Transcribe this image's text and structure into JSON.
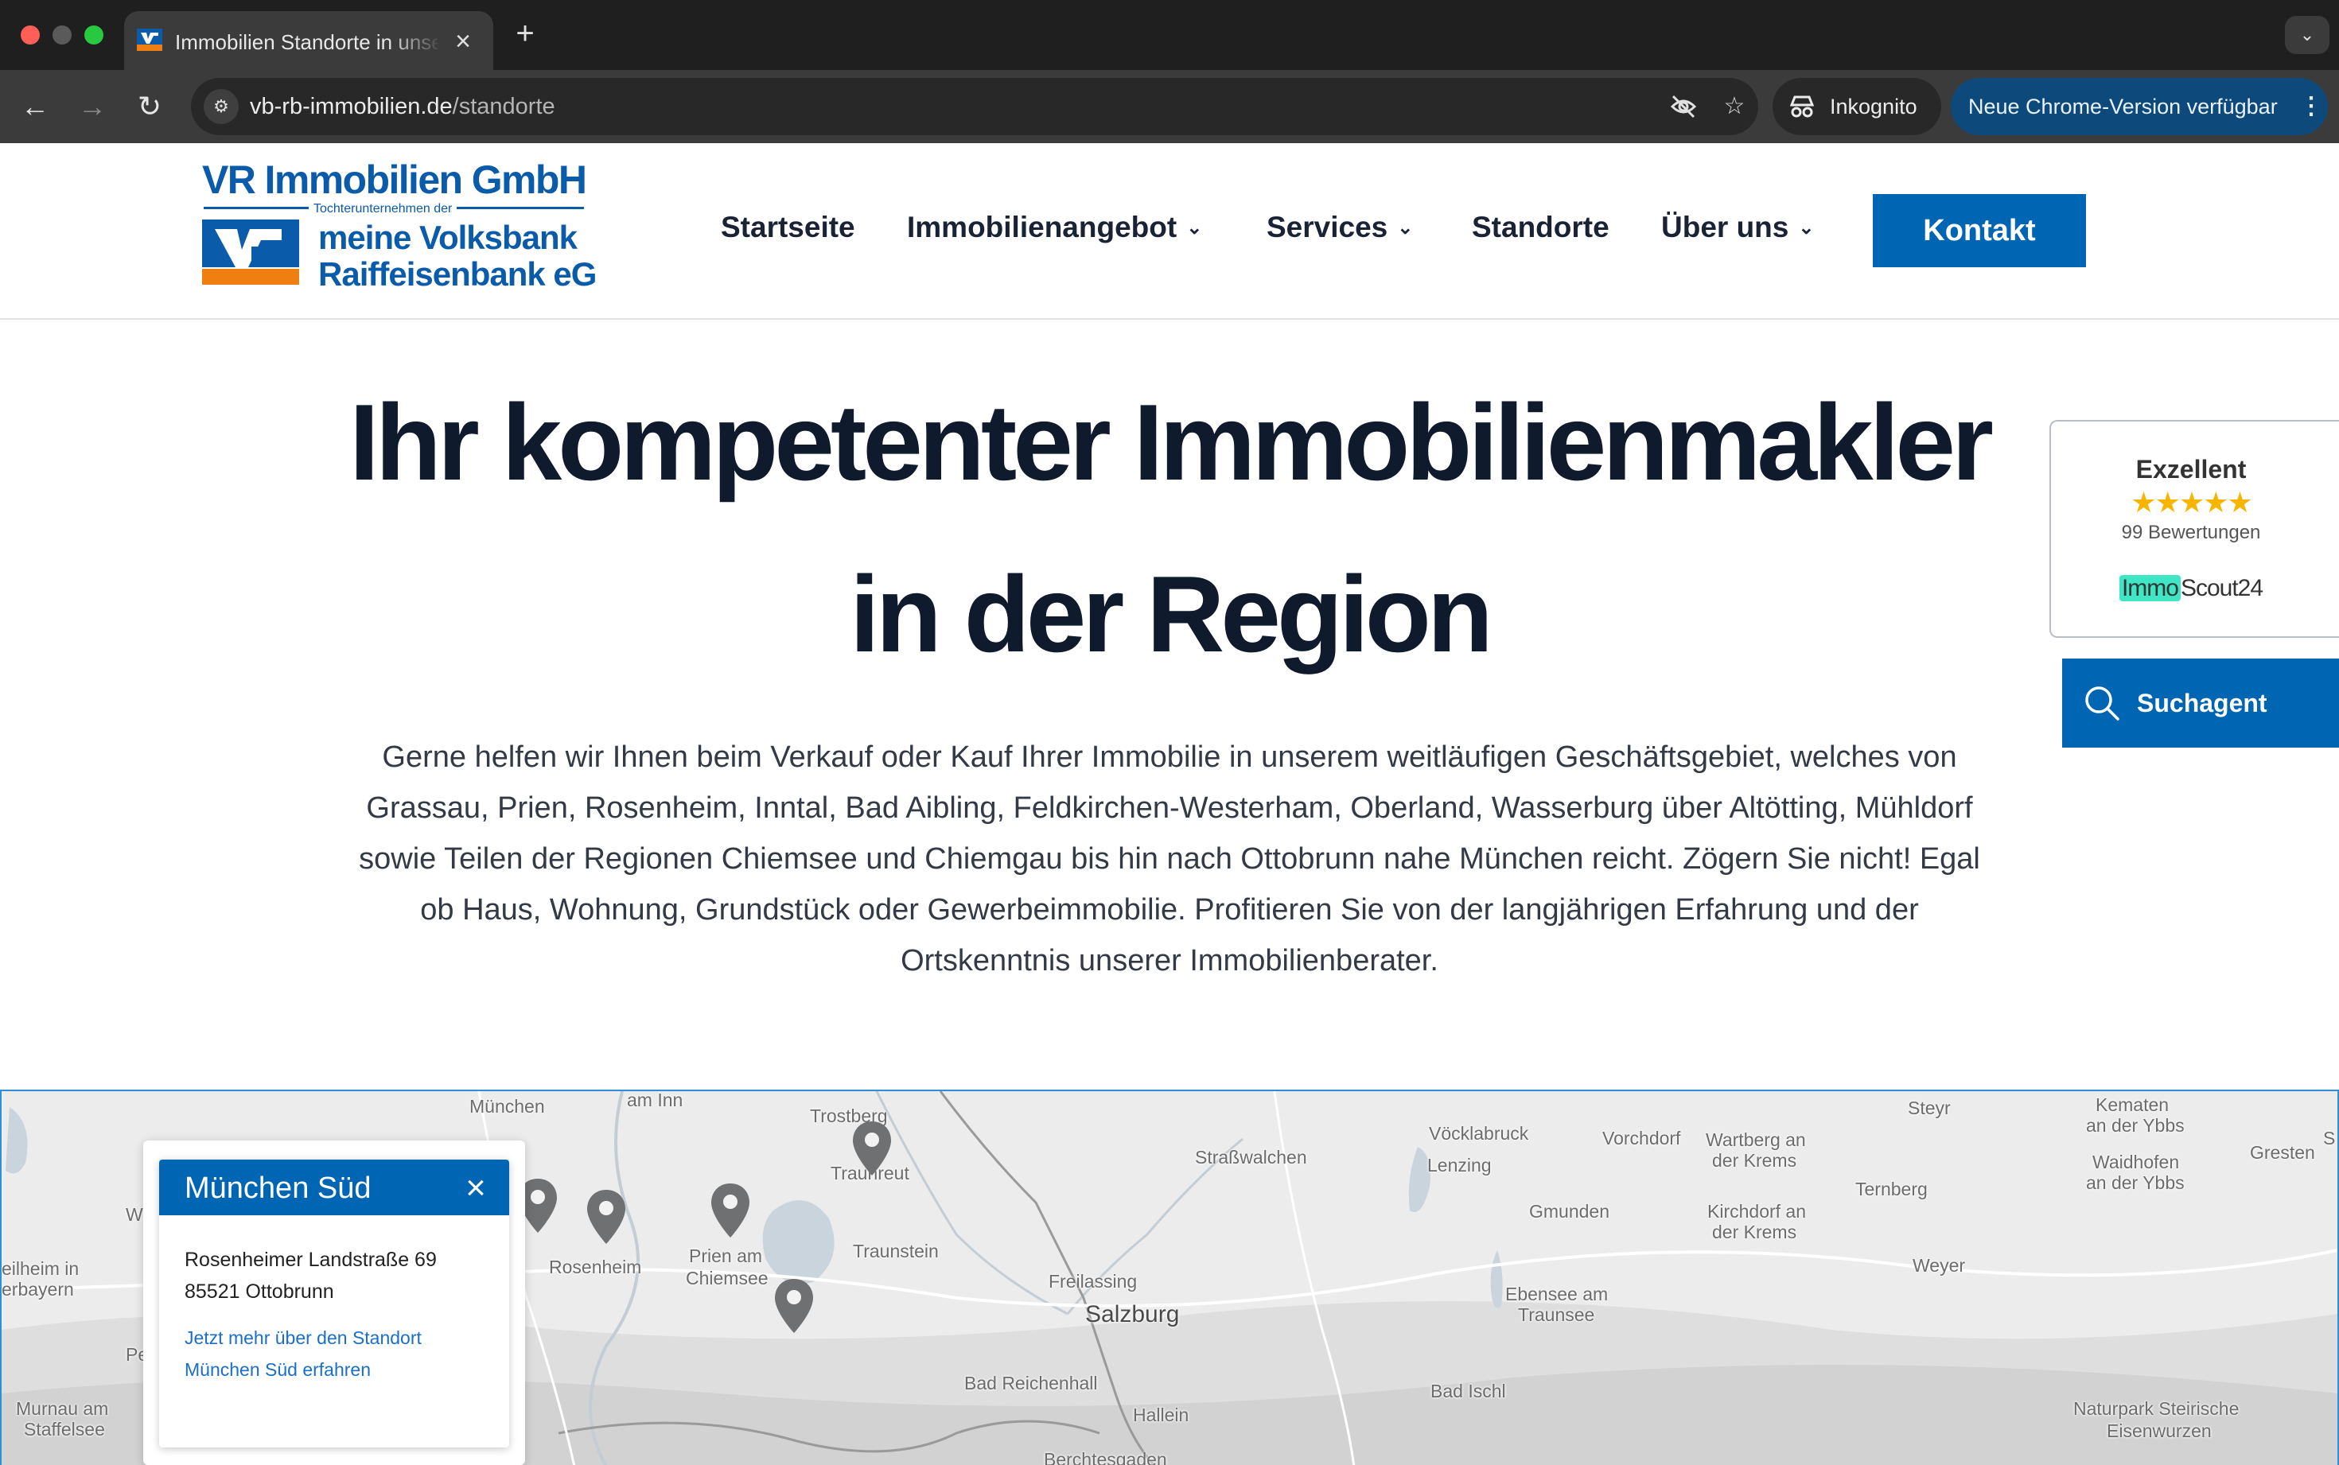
{
  "browser": {
    "tab_title": "Immobilien Standorte in unserer Region",
    "new_tab_symbol": "+",
    "close_symbol": "×",
    "url_domain": "vb-rb-immobilien.de",
    "url_path": "/standorte",
    "incognito_label": "Inkognito",
    "update_label": "Neue Chrome-Version verfügbar",
    "icons": [
      "back-arrow-icon",
      "forward-arrow-icon",
      "reload-icon",
      "site-info-icon",
      "eye-off-icon",
      "star-icon",
      "incognito-icon",
      "more-vert-icon",
      "chevron-down-icon"
    ]
  },
  "header": {
    "logo": {
      "title": "VR Immobilien GmbH",
      "subtitle": "Tochterunternehmen der",
      "bank_line1": "meine Volksbank",
      "bank_line2": "Raiffeisenbank eG"
    },
    "nav": [
      {
        "label": "Startseite",
        "has_dropdown": false
      },
      {
        "label": "Immobilienangebot",
        "has_dropdown": true
      },
      {
        "label": "Services",
        "has_dropdown": true
      },
      {
        "label": "Standorte",
        "has_dropdown": false
      },
      {
        "label": "Über uns",
        "has_dropdown": true
      }
    ],
    "cta": "Kontakt"
  },
  "hero": {
    "line1": "Ihr kompetenter Immobilienmakler",
    "line2": "in der Region",
    "intro": "Gerne helfen wir Ihnen beim Verkauf oder Kauf Ihrer Immobilie in unserem weitläufigen Geschäftsgebiet, welches von Grassau, Prien, Rosenheim, Inntal, Bad Aibling, Feldkirchen-Westerham, Oberland, Wasserburg über Altötting, Mühldorf sowie Teilen der Regionen Chiemsee und Chiemgau bis hin nach Ottobrunn nahe München reicht. Zögern Sie nicht! Egal ob Haus, Wohnung, Grundstück oder Gewerbeimmobilie. Profitieren Sie von der langjährigen Erfahrung und der Ortskenntnis unserer Immobilienberater."
  },
  "rating": {
    "title": "Exzellent",
    "stars": 5,
    "stars_text": "★★★★★",
    "count": "99 Bewertungen",
    "brand_part1": "Immo",
    "brand_part2": "Scout24"
  },
  "suchagent": {
    "label": "Suchagent"
  },
  "map": {
    "labels": [
      {
        "text": "München"
      },
      {
        "text": "am Inn"
      },
      {
        "text": "Trostberg"
      },
      {
        "text": "Traunreut"
      },
      {
        "text": "Straßwalchen"
      },
      {
        "text": "Vöcklabruck"
      },
      {
        "text": "Lenzing"
      },
      {
        "text": "Vorchdorf"
      },
      {
        "text": "Wartberg an"
      },
      {
        "text": "der Krems"
      },
      {
        "text": "Steyr"
      },
      {
        "text": "Kematen"
      },
      {
        "text": "an der Ybbs"
      },
      {
        "text": "Gresten"
      },
      {
        "text": "Waidhofen"
      },
      {
        "text": "an der Ybbs"
      },
      {
        "text": "Ternberg"
      },
      {
        "text": "Gmunden"
      },
      {
        "text": "Kirchdorf an"
      },
      {
        "text": "der Krems"
      },
      {
        "text": "Rosenheim"
      },
      {
        "text": "Prien am"
      },
      {
        "text": "Chiemsee"
      },
      {
        "text": "Traunstein"
      },
      {
        "text": "Freilassing"
      },
      {
        "text": "Salzburg"
      },
      {
        "text": "Ebensee am"
      },
      {
        "text": "Traunsee"
      },
      {
        "text": "Weyer"
      },
      {
        "text": "Bad Reichenhall"
      },
      {
        "text": "Hallein"
      },
      {
        "text": "Bad Ischl"
      },
      {
        "text": "Naturpark Steirische"
      },
      {
        "text": "Eisenwurzen"
      },
      {
        "text": "Berchtesgaden"
      },
      {
        "text": "eilheim in"
      },
      {
        "text": "erbayern"
      },
      {
        "text": "Murnau am"
      },
      {
        "text": "Staffelsee"
      },
      {
        "text": "W"
      },
      {
        "text": "Pe"
      },
      {
        "text": "S"
      }
    ],
    "pins": 6,
    "popup": {
      "title": "München Süd",
      "street": "Rosenheimer Landstraße 69",
      "city": "85521 Ottobrunn",
      "link_line1": "Jetzt mehr über den Standort",
      "link_line2": "München Süd erfahren"
    }
  },
  "colors": {
    "brand_blue": "#0066b3",
    "logo_blue": "#0a5ba9",
    "logo_orange": "#f07f12",
    "heading": "#0f1b2d",
    "star": "#f7b500",
    "immoscout_highlight": "#3ee6c3"
  }
}
